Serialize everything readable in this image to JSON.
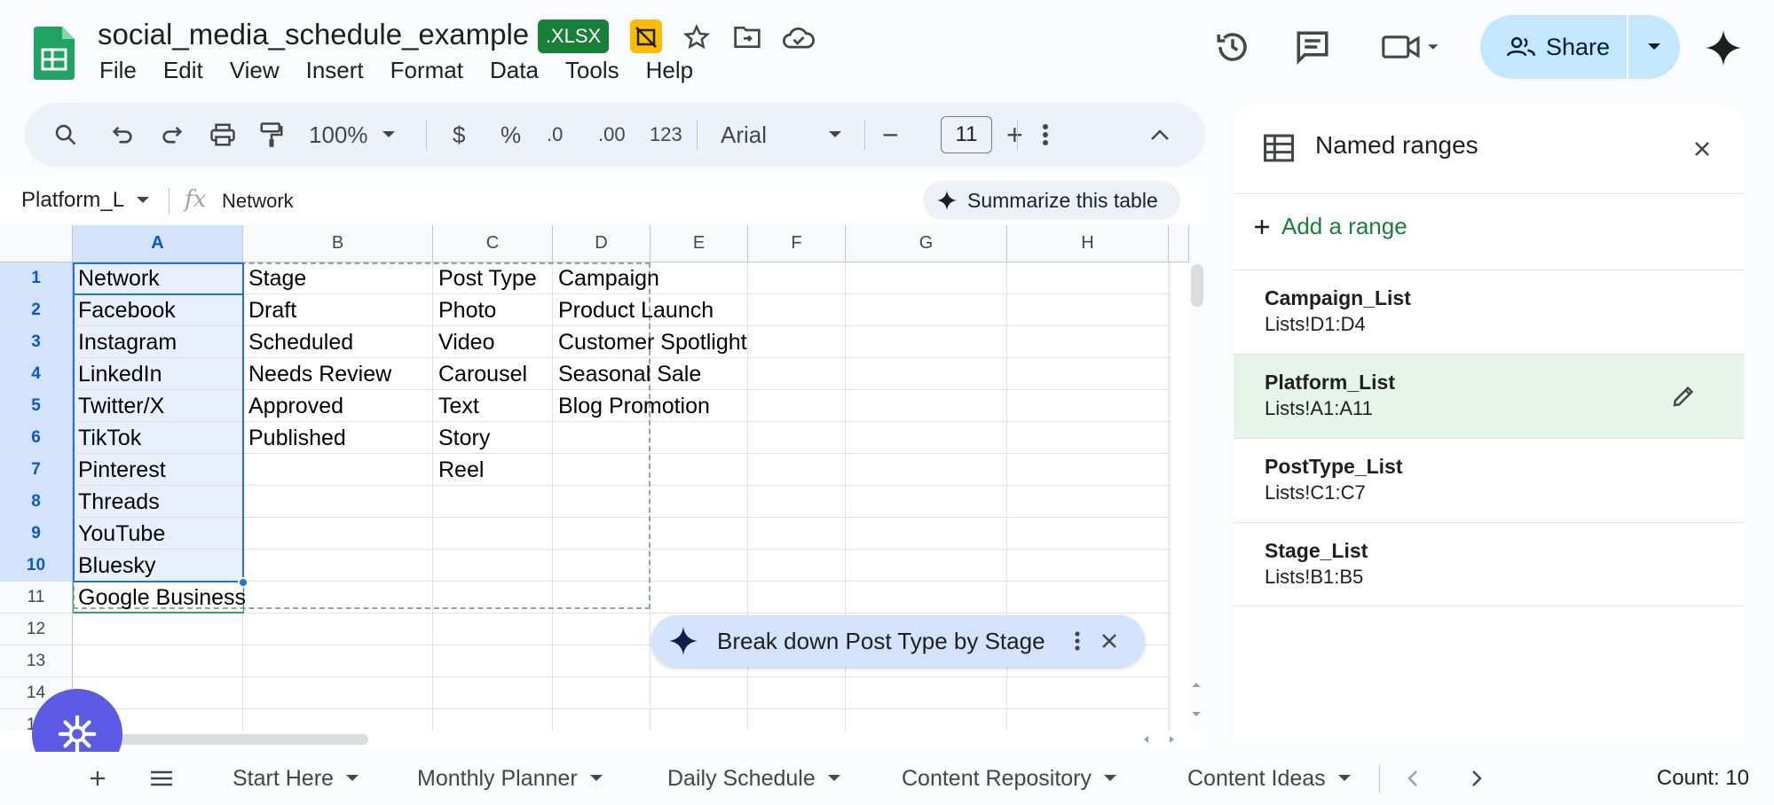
{
  "header": {
    "title": "social_media_schedule_example",
    "file_badge": ".XLSX",
    "menu": [
      "File",
      "Edit",
      "View",
      "Insert",
      "Format",
      "Data",
      "Tools",
      "Help"
    ],
    "share_label": "Share"
  },
  "toolbar": {
    "zoom": "100%",
    "currency": "$",
    "percent": "%",
    "decrease_decimal": ".0",
    "increase_decimal": ".00",
    "number_format": "123",
    "font": "Arial",
    "font_size": "11",
    "minus": "−",
    "plus": "+"
  },
  "formula_bar": {
    "name_box": "Platform_L",
    "fx": "fx",
    "value": "Network",
    "summarize_label": "Summarize this table"
  },
  "grid": {
    "columns": [
      "A",
      "B",
      "C",
      "D",
      "E",
      "F",
      "G",
      "H"
    ],
    "rows": [
      "1",
      "2",
      "3",
      "4",
      "5",
      "6",
      "7",
      "8",
      "9",
      "10",
      "11",
      "12",
      "13",
      "14",
      "15"
    ],
    "col_a": [
      "Network",
      "Facebook",
      "Instagram",
      "LinkedIn",
      "Twitter/X",
      "TikTok",
      "Pinterest",
      "Threads",
      "YouTube",
      "Bluesky",
      "Google Business"
    ],
    "col_b": [
      "Stage",
      "Draft",
      "Scheduled",
      "Needs Review",
      "Approved",
      "Published"
    ],
    "col_c": [
      "Post Type",
      "Photo",
      "Video",
      "Carousel",
      "Text",
      "Story",
      "Reel"
    ],
    "col_d": [
      "Campaign",
      "Product Launch",
      "Customer Spotlight",
      "Seasonal Sale",
      "Blog Promotion"
    ]
  },
  "ai_suggestion": "Break down Post Type by Stage",
  "panel": {
    "title": "Named ranges",
    "add_label": "Add a range",
    "ranges": [
      {
        "name": "Campaign_List",
        "ref": "Lists!D1:D4"
      },
      {
        "name": "Platform_List",
        "ref": "Lists!A1:A11"
      },
      {
        "name": "PostType_List",
        "ref": "Lists!C1:C7"
      },
      {
        "name": "Stage_List",
        "ref": "Lists!B1:B5"
      }
    ]
  },
  "tabs": [
    "Start Here",
    "Monthly Planner",
    "Daily Schedule",
    "Content Repository",
    "Content Ideas"
  ],
  "status": {
    "count": "Count: 10"
  },
  "colors": {
    "accent": "#0b57d0",
    "green": "#188038",
    "share_bg": "#c2e7ff",
    "active_range": "#e6f4ea"
  }
}
